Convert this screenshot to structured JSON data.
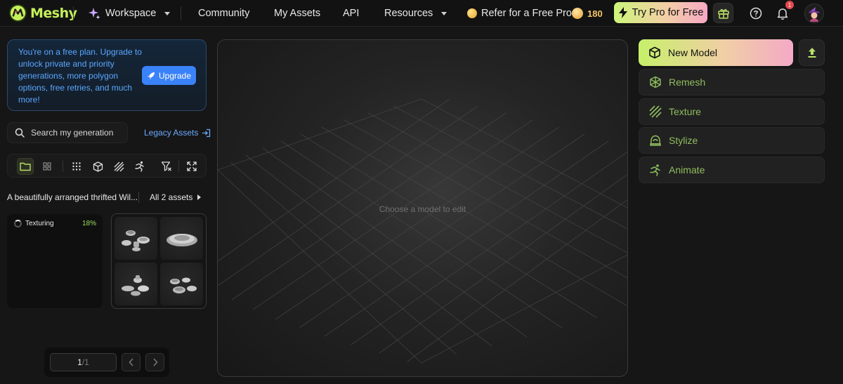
{
  "nav": {
    "brand": "Meshy",
    "workspace": "Workspace",
    "community": "Community",
    "my_assets": "My Assets",
    "api": "API",
    "resources": "Resources",
    "refer": "Refer for a Free Pro",
    "credits": "180",
    "try_pro": "Try Pro for Free",
    "notification_count": "1"
  },
  "promo": {
    "text": "You're on a free plan. Upgrade to unlock private and priority generations, more polygon options, free retries, and much more!",
    "upgrade": "Upgrade"
  },
  "search": {
    "placeholder": "Search my generation",
    "legacy": "Legacy Assets"
  },
  "generation": {
    "prompt": "A beautifully arranged thrifted Wil...",
    "all_assets": "All 2 assets",
    "texturing_label": "Texturing",
    "texturing_percent": "18%"
  },
  "pager": {
    "current": "1",
    "total": "/1"
  },
  "viewport": {
    "hint": "Choose a model to edit"
  },
  "tools": {
    "new_model": "New Model",
    "remesh": "Remesh",
    "texture": "Texture",
    "stylize": "Stylize",
    "animate": "Animate"
  },
  "colors": {
    "accent_green": "#c5f05a",
    "link_blue": "#5aa7ff",
    "upgrade_blue": "#3a82f7",
    "tool_green": "#8fbd5e",
    "credits_gold": "#f3c66a",
    "percent_green": "#9be05a"
  }
}
